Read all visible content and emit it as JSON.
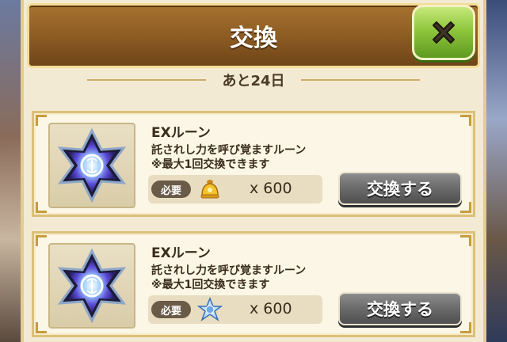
{
  "header": {
    "title": "交換",
    "close_icon": "close-x-icon"
  },
  "banner": {
    "remaining": "あと24日"
  },
  "items": [
    {
      "name": "EXルーン",
      "description": "託されし力を呼び覚ますルーン",
      "note": "※最大1回交換できます",
      "required_label": "必要",
      "cost_icon": "golden-bell-icon",
      "cost_amount": "x 600",
      "button_label": "交換する"
    },
    {
      "name": "EXルーン",
      "description": "託されし力を呼び覚ますルーン",
      "note": "※最大1回交換できます",
      "required_label": "必要",
      "cost_icon": "blue-crystal-icon",
      "cost_amount": "x 600",
      "button_label": "交換する"
    }
  ],
  "colors": {
    "title_bar": "#8a5a22",
    "close_button": "#8fc63d",
    "exchange_button": "#6a6a6a"
  }
}
